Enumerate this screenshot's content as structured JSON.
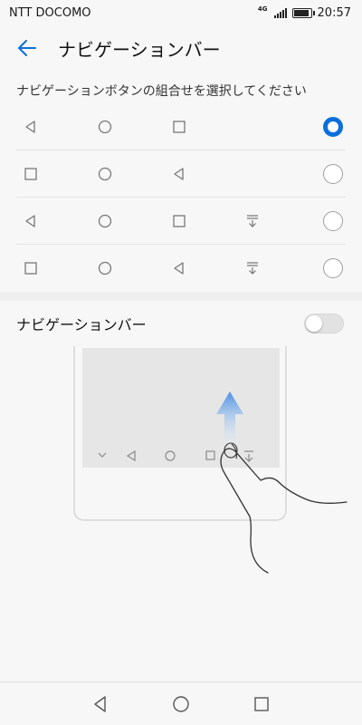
{
  "status_bar": {
    "carrier": "NTT DOCOMO",
    "network": "4G",
    "time": "20:57",
    "battery_level": 0.9
  },
  "app_bar": {
    "back_icon": "arrow-left-icon",
    "title": "ナビゲーションバー"
  },
  "section": {
    "header": "ナビゲーションボタンの組合せを選択してください"
  },
  "nav_options": [
    {
      "keys": [
        "back",
        "home",
        "recent"
      ],
      "selected": true
    },
    {
      "keys": [
        "recent",
        "home",
        "back"
      ],
      "selected": false
    },
    {
      "keys": [
        "back",
        "home",
        "recent",
        "notification"
      ],
      "selected": false
    },
    {
      "keys": [
        "recent",
        "home",
        "back",
        "notification"
      ],
      "selected": false
    }
  ],
  "navigation_bar_toggle": {
    "label": "ナビゲーションバー",
    "enabled": false
  },
  "bottom_nav": {
    "buttons": [
      "back",
      "home",
      "recent"
    ]
  },
  "colors": {
    "accent": "#0a6fdb",
    "arrow_gradient_top": "#4a90e2",
    "background": "#f7f7f7"
  }
}
